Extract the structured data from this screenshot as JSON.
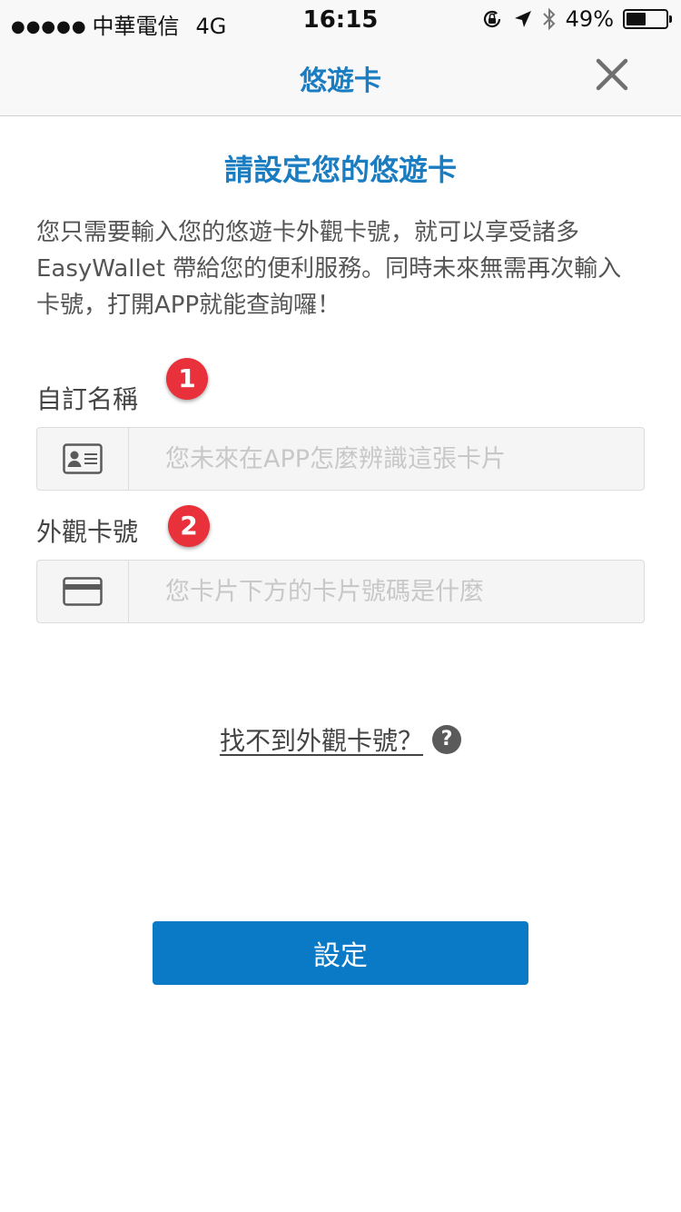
{
  "status_bar": {
    "signal_dots": "●●●●●",
    "carrier": "中華電信",
    "network": "4G",
    "time": "16:15",
    "battery_percent": "49%",
    "battery_level": 0.49,
    "icons": [
      "rotation-lock-icon",
      "location-arrow-icon",
      "bluetooth-icon",
      "battery-icon"
    ]
  },
  "nav": {
    "title": "悠遊卡",
    "close_icon": "close-icon"
  },
  "main": {
    "heading": "請設定您的悠遊卡",
    "description": "您只需要輸入您的悠遊卡外觀卡號，就可以享受諸多EasyWallet 帶給您的便利服務。同時未來無需再次輸入卡號，打開APP就能查詢囉！",
    "fields": [
      {
        "label": "自訂名稱",
        "badge": "1",
        "icon": "id-card-icon",
        "value": "",
        "placeholder": "您未來在APP怎麼辨識這張卡片"
      },
      {
        "label": "外觀卡號",
        "badge": "2",
        "icon": "credit-card-icon",
        "value": "",
        "placeholder": "您卡片下方的卡片號碼是什麼"
      }
    ],
    "help_link": "找不到外觀卡號？",
    "help_icon_glyph": "?",
    "submit_label": "設定"
  },
  "colors": {
    "accent": "#1a7cc1",
    "button": "#0b7ac6",
    "badge": "#e8313a"
  }
}
